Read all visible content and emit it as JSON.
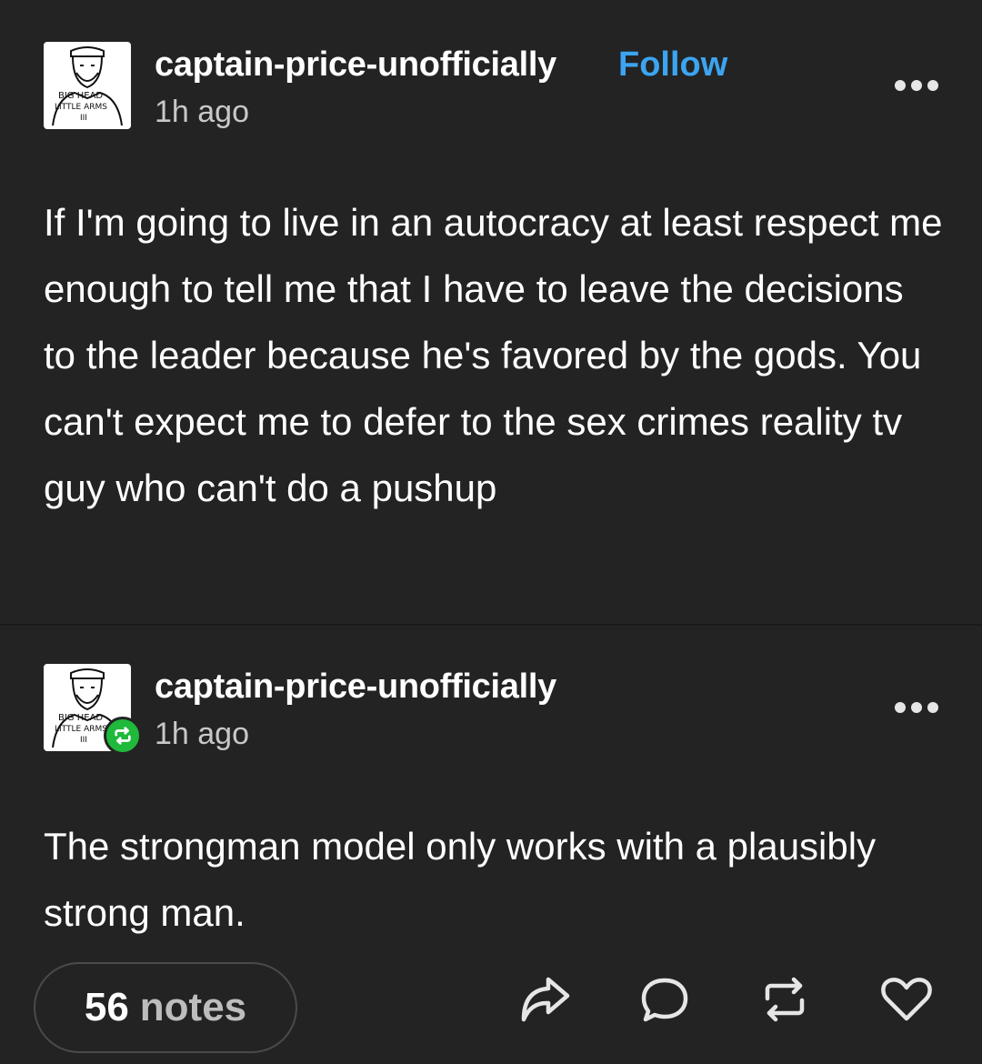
{
  "post": {
    "author": "captain-price-unofficially",
    "follow_label": "Follow",
    "time": "1h ago",
    "avatar_text": [
      "BIG HEAD",
      "LITTLE ARMS",
      "III"
    ],
    "body": "If I'm going to live in an autocracy at least respect me enough to tell me that I have to leave the decisions to the leader because he's favored by the gods. You can't expect me to defer to the sex crimes reality tv guy who can't do a pushup"
  },
  "reblog": {
    "author": "captain-price-unofficially",
    "time": "1h ago",
    "body": "The strongman model only works with a plausibly strong man."
  },
  "footer": {
    "notes_count": "56",
    "notes_label": "notes"
  },
  "icons": {
    "more": "more-horizontal-icon",
    "share": "share-icon",
    "reply": "reply-icon",
    "reblog": "reblog-icon",
    "like": "heart-icon",
    "reblog_badge": "reblog-badge-icon"
  },
  "colors": {
    "background": "#232323",
    "follow": "#3ca4f0",
    "reblog_badge": "#1fb93b"
  }
}
